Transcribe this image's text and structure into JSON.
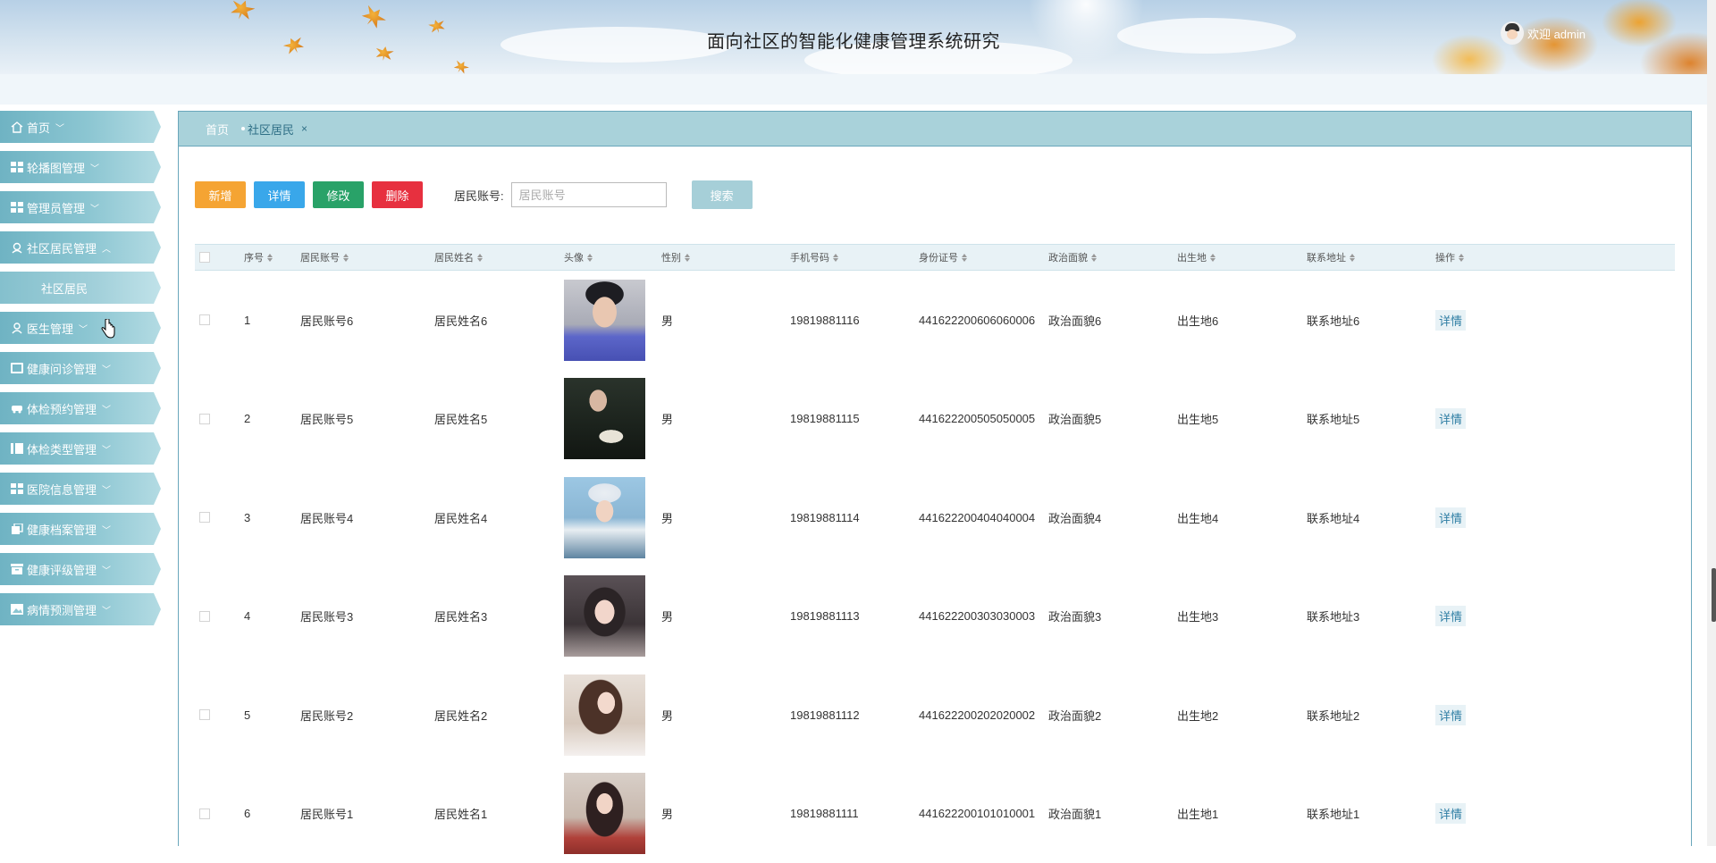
{
  "header": {
    "title": "面向社区的智能化健康管理系统研究",
    "welcome": "欢迎 admin"
  },
  "sidebar": {
    "items": [
      {
        "label": "首页",
        "icon": "home-icon",
        "arrow": "﹀"
      },
      {
        "label": "轮播图管理",
        "icon": "grid-icon",
        "arrow": "﹀"
      },
      {
        "label": "管理员管理",
        "icon": "grid-icon",
        "arrow": "﹀"
      },
      {
        "label": "社区居民管理",
        "icon": "person-icon",
        "arrow": "︿"
      },
      {
        "label": "社区居民",
        "icon": "",
        "arrow": ""
      },
      {
        "label": "医生管理",
        "icon": "person-icon",
        "arrow": "﹀"
      },
      {
        "label": "健康问诊管理",
        "icon": "doc-icon",
        "arrow": "﹀"
      },
      {
        "label": "体检预约管理",
        "icon": "car-icon",
        "arrow": "﹀"
      },
      {
        "label": "体检类型管理",
        "icon": "list-icon",
        "arrow": "﹀"
      },
      {
        "label": "医院信息管理",
        "icon": "grid-icon",
        "arrow": "﹀"
      },
      {
        "label": "健康档案管理",
        "icon": "copy-icon",
        "arrow": "﹀"
      },
      {
        "label": "健康评级管理",
        "icon": "archive-icon",
        "arrow": "﹀"
      },
      {
        "label": "病情预测管理",
        "icon": "image-icon",
        "arrow": "﹀"
      }
    ]
  },
  "tabs": {
    "home": "首页",
    "current": "社区居民",
    "close": "×"
  },
  "toolbar": {
    "add": "新增",
    "detail": "详情",
    "edit": "修改",
    "delete": "删除",
    "search_label": "居民账号:",
    "search_placeholder": "居民账号",
    "search_button": "搜索"
  },
  "table": {
    "headers": [
      "序号",
      "居民账号",
      "居民姓名",
      "头像",
      "性别",
      "手机号码",
      "身份证号",
      "政治面貌",
      "出生地",
      "联系地址",
      "操作"
    ],
    "rows": [
      {
        "idx": "1",
        "account": "居民账号6",
        "name": "居民姓名6",
        "sex": "男",
        "phone": "19819881116",
        "id": "441622200606060006",
        "political": "政治面貌6",
        "birth": "出生地6",
        "address": "联系地址6",
        "op": "详情"
      },
      {
        "idx": "2",
        "account": "居民账号5",
        "name": "居民姓名5",
        "sex": "男",
        "phone": "19819881115",
        "id": "441622200505050005",
        "political": "政治面貌5",
        "birth": "出生地5",
        "address": "联系地址5",
        "op": "详情"
      },
      {
        "idx": "3",
        "account": "居民账号4",
        "name": "居民姓名4",
        "sex": "男",
        "phone": "19819881114",
        "id": "441622200404040004",
        "political": "政治面貌4",
        "birth": "出生地4",
        "address": "联系地址4",
        "op": "详情"
      },
      {
        "idx": "4",
        "account": "居民账号3",
        "name": "居民姓名3",
        "sex": "男",
        "phone": "19819881113",
        "id": "441622200303030003",
        "political": "政治面貌3",
        "birth": "出生地3",
        "address": "联系地址3",
        "op": "详情"
      },
      {
        "idx": "5",
        "account": "居民账号2",
        "name": "居民姓名2",
        "sex": "男",
        "phone": "19819881112",
        "id": "441622200202020002",
        "political": "政治面貌2",
        "birth": "出生地2",
        "address": "联系地址2",
        "op": "详情"
      },
      {
        "idx": "6",
        "account": "居民账号1",
        "name": "居民姓名1",
        "sex": "男",
        "phone": "19819881111",
        "id": "441622200101010001",
        "political": "政治面貌1",
        "birth": "出生地1",
        "address": "联系地址1",
        "op": "详情"
      }
    ]
  },
  "colors": {
    "add": "#f5a433",
    "detail": "#39a7ea",
    "edit": "#29a268",
    "delete": "#e7303f",
    "search": "#a6cfd8",
    "nav": "#6fb3c3"
  }
}
